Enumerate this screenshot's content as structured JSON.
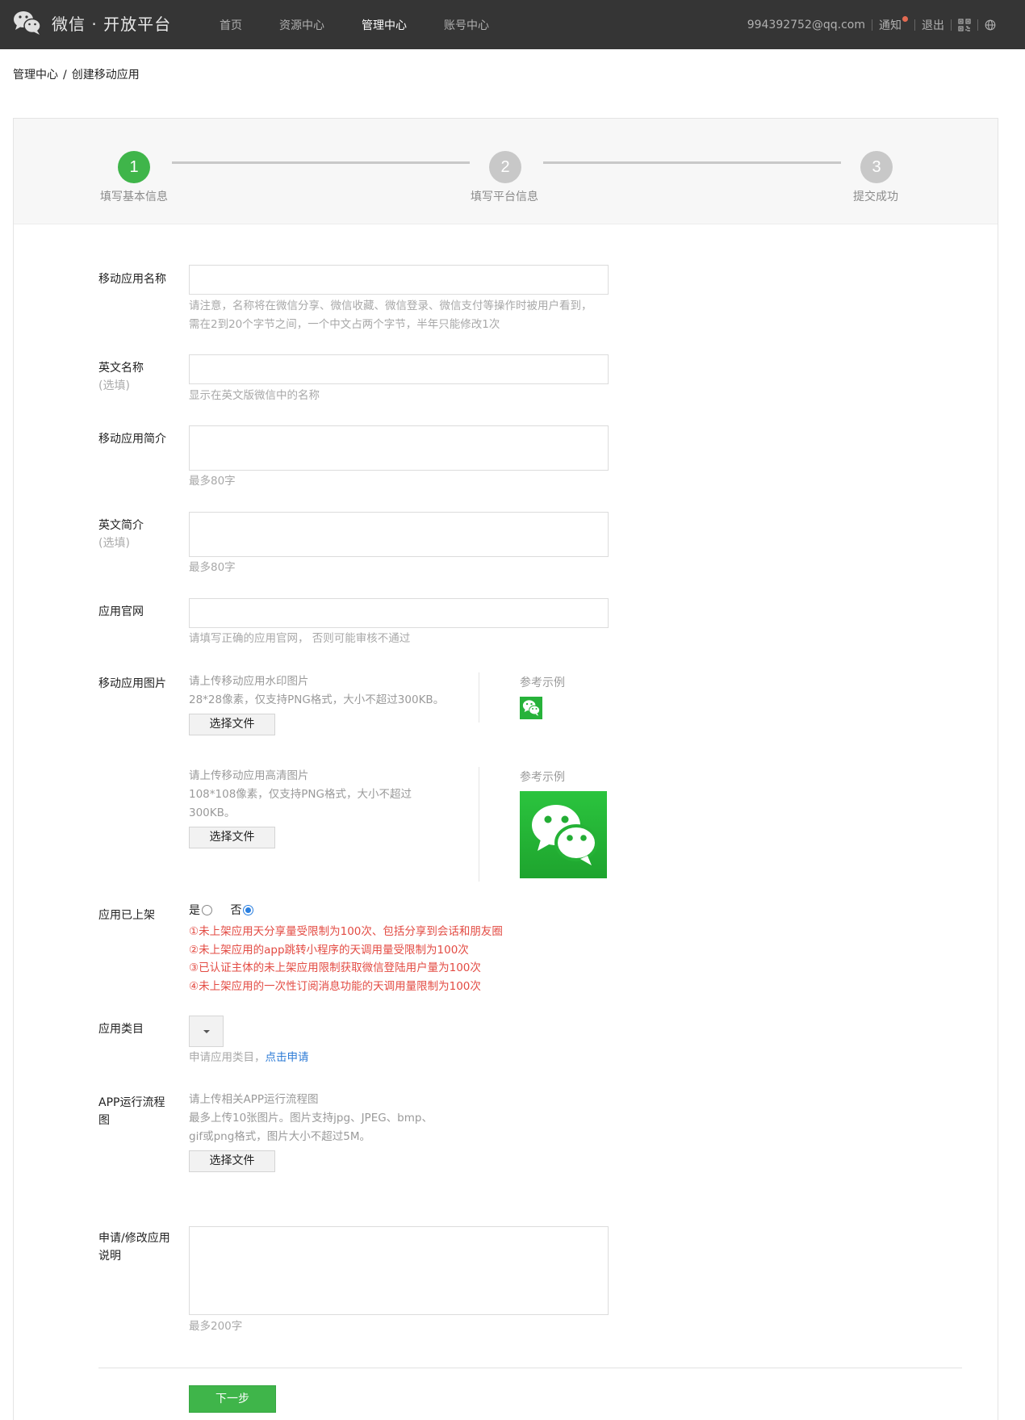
{
  "header": {
    "brand": "微信 · 开放平台",
    "nav": [
      "首页",
      "资源中心",
      "管理中心",
      "账号中心"
    ],
    "active_nav": 2,
    "account": "994392752@qq.com",
    "notice": "通知",
    "logout": "退出"
  },
  "breadcrumb": {
    "parent": "管理中心",
    "sep": "/",
    "current": "创建移动应用"
  },
  "steps": [
    {
      "num": "1",
      "label": "填写基本信息",
      "status": "done"
    },
    {
      "num": "2",
      "label": "填写平台信息",
      "status": "todo"
    },
    {
      "num": "3",
      "label": "提交成功",
      "status": "todo"
    }
  ],
  "form": {
    "app_name": {
      "label": "移动应用名称",
      "hint1": "请注意，名称将在微信分享、微信收藏、微信登录、微信支付等操作时被用户看到，",
      "hint2": "需在2到20个字节之间，一个中文占两个字节，半年只能修改1次"
    },
    "en_name": {
      "label": "英文名称",
      "optional": "(选填)",
      "hint": "显示在英文版微信中的名称"
    },
    "intro": {
      "label": "移动应用简介",
      "hint": "最多80字"
    },
    "en_intro": {
      "label": "英文简介",
      "optional": "(选填)",
      "hint": "最多80字"
    },
    "website": {
      "label": "应用官网",
      "hint": "请填写正确的应用官网， 否则可能审核不通过"
    },
    "images": {
      "label": "移动应用图片",
      "small_hint1": "请上传移动应用水印图片",
      "small_hint2": "28*28像素，仅支持PNG格式，大小不超过300KB。",
      "large_hint1": "请上传移动应用高清图片",
      "large_hint2": "108*108像素，仅支持PNG格式，大小不超过",
      "large_hint3": "300KB。",
      "choose_file": "选择文件",
      "ref_label": "参考示例"
    },
    "listed": {
      "label": "应用已上架",
      "yes": "是",
      "no": "否",
      "selected": "否",
      "notes": [
        "①未上架应用天分享量受限制为100次、包括分享到会话和朋友圈",
        "②未上架应用的app跳转小程序的天调用量受限制为100次",
        "③已认证主体的未上架应用限制获取微信登陆用户量为100次",
        "④未上架应用的一次性订阅消息功能的天调用量限制为100次"
      ]
    },
    "category": {
      "label": "应用类目",
      "hint": "申请应用类目，",
      "link": "点击申请"
    },
    "flowchart": {
      "label_line1": "APP运行流程",
      "label_line2": "图",
      "hint1": "请上传相关APP运行流程图",
      "hint2": "最多上传10张图片。图片支持jpg、JPEG、bmp、",
      "hint3": "gif或png格式，图片大小不超过5M。",
      "choose_file": "选择文件"
    },
    "explain": {
      "label_line1": "申请/修改应用",
      "label_line2": "说明",
      "hint": "最多200字"
    },
    "next_button": "下一步"
  },
  "colors": {
    "topbar": "#353535",
    "accent_green": "#3fb54a",
    "warning_red": "#e34b43",
    "link_blue": "#2d7bd6"
  }
}
